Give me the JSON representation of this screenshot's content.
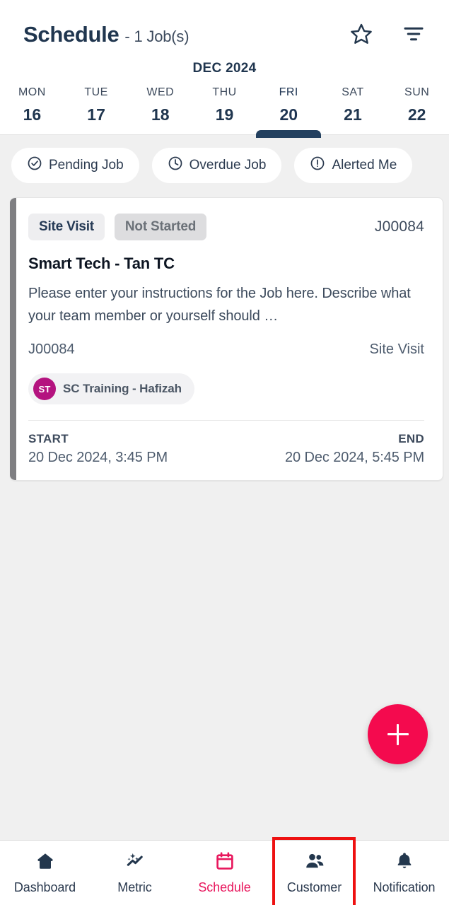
{
  "header": {
    "title_main": "Schedule",
    "title_sub": "- 1 Job(s)",
    "star_icon": "star-outline-icon",
    "filter_icon": "filter-lines-icon"
  },
  "calendar": {
    "month_label": "DEC 2024",
    "days": [
      {
        "name": "MON",
        "num": "16",
        "selected": false
      },
      {
        "name": "TUE",
        "num": "17",
        "selected": false
      },
      {
        "name": "WED",
        "num": "18",
        "selected": false
      },
      {
        "name": "THU",
        "num": "19",
        "selected": false
      },
      {
        "name": "FRI",
        "num": "20",
        "selected": true
      },
      {
        "name": "SAT",
        "num": "21",
        "selected": false
      },
      {
        "name": "SUN",
        "num": "22",
        "selected": false
      }
    ]
  },
  "filters": [
    {
      "label": "Pending Job",
      "icon": "check-circle-icon"
    },
    {
      "label": "Overdue Job",
      "icon": "clock-icon"
    },
    {
      "label": "Alerted Me",
      "icon": "exclamation-circle-icon"
    }
  ],
  "job_card": {
    "badge_type": "Site Visit",
    "badge_status": "Not Started",
    "job_id_top": "J00084",
    "title": "Smart Tech - Tan TC",
    "description": "Please enter your instructions for the Job here. Describe what your team member or yourself should …",
    "meta_left": "J00084",
    "meta_right": "Site Visit",
    "assignee_initials": "ST",
    "assignee_name": "SC Training - Hafizah",
    "start_label": "START",
    "start_value": "20 Dec 2024, 3:45 PM",
    "end_label": "END",
    "end_value": "20 Dec 2024, 5:45 PM",
    "stripe_color": "#7f7f82",
    "avatar_color": "#b4137f"
  },
  "fab": {
    "icon": "plus-icon",
    "color": "#f40a4e"
  },
  "bottom_nav": {
    "items": [
      {
        "label": "Dashboard",
        "icon": "home-icon",
        "active": false,
        "highlighted": false
      },
      {
        "label": "Metric",
        "icon": "sparkle-chart-icon",
        "active": false,
        "highlighted": false
      },
      {
        "label": "Schedule",
        "icon": "calendar-icon",
        "active": true,
        "highlighted": false
      },
      {
        "label": "Customer",
        "icon": "people-icon",
        "active": false,
        "highlighted": true
      },
      {
        "label": "Notification",
        "icon": "bell-icon",
        "active": false,
        "highlighted": false
      }
    ],
    "active_color": "#e8175d",
    "highlight_color": "#ee1111"
  }
}
